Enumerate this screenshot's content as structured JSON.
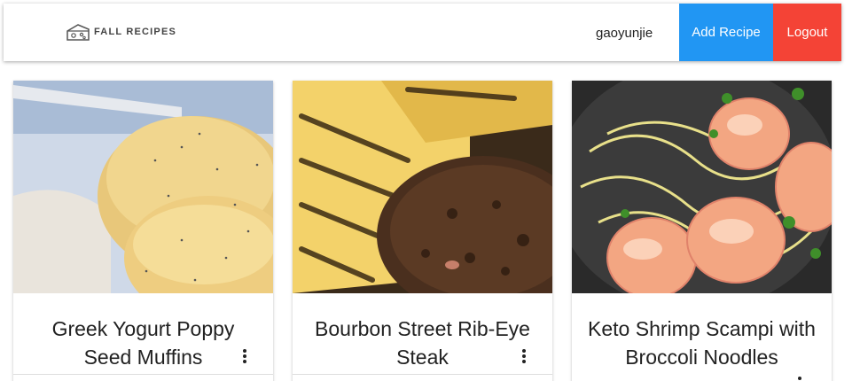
{
  "navbar": {
    "brand_text": "FALL RECIPES",
    "username": "gaoyunjie",
    "add_recipe_label": "Add Recipe",
    "logout_label": "Logout",
    "add_color": "#2196f3",
    "logout_color": "#f44336"
  },
  "recipes": [
    {
      "title": "Greek Yogurt Poppy Seed Muffins",
      "image": "muffin-photo"
    },
    {
      "title": "Bourbon Street Rib-Eye Steak",
      "image": "steak-photo"
    },
    {
      "title": "Keto Shrimp Scampi with Broccoli Noodles",
      "image": "shrimp-photo"
    }
  ]
}
